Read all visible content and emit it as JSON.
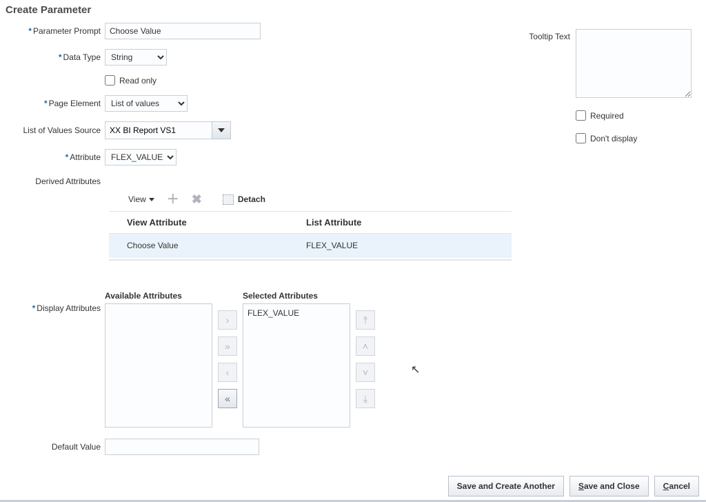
{
  "page_title": "Create Parameter",
  "left": {
    "parameter_prompt_label": "Parameter Prompt",
    "parameter_prompt_value": "Choose Value",
    "data_type_label": "Data Type",
    "data_type_value": "String",
    "read_only_label": "Read only",
    "page_element_label": "Page Element",
    "page_element_value": "List of values",
    "lov_source_label": "List of Values Source",
    "lov_source_value": "XX BI Report VS1",
    "attribute_label": "Attribute",
    "attribute_value": "FLEX_VALUE",
    "derived_attributes_label": "Derived Attributes",
    "display_attributes_label": "Display Attributes",
    "default_value_label": "Default Value",
    "default_value_value": ""
  },
  "right": {
    "tooltip_label": "Tooltip Text",
    "tooltip_value": "",
    "required_label": "Required",
    "dont_display_label": "Don't display"
  },
  "toolbar": {
    "view_label": "View",
    "detach_label": "Detach"
  },
  "table": {
    "col_a": "View Attribute",
    "col_b": "List Attribute",
    "row1_a": "Choose Value",
    "row1_b": "FLEX_VALUE"
  },
  "shuttle": {
    "available_label": "Available Attributes",
    "selected_label": "Selected Attributes",
    "selected_item_0": "FLEX_VALUE"
  },
  "footer": {
    "save_create_another": "Save and Create Another",
    "save_close_prefix": "S",
    "save_close_rest": "ave and Close",
    "cancel_prefix": "C",
    "cancel_rest": "ancel"
  }
}
